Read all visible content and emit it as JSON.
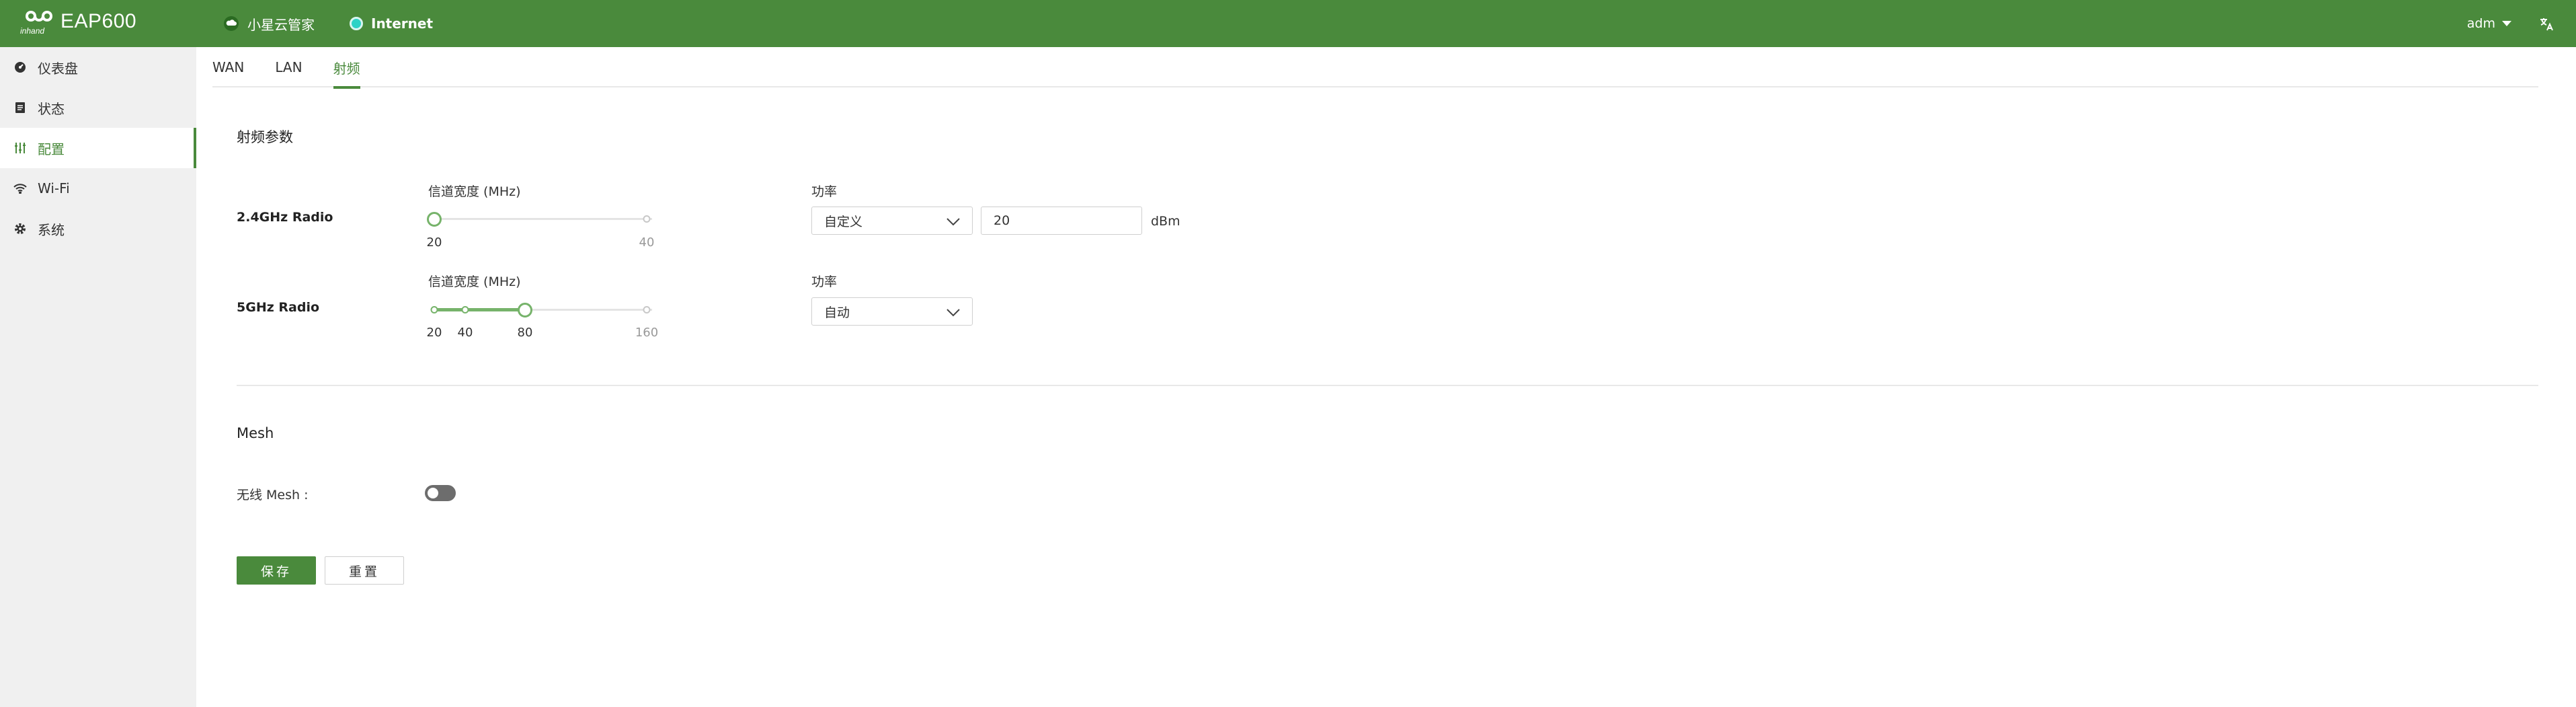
{
  "header": {
    "brand": "EAP600",
    "nav": [
      {
        "label": "小星云管家",
        "icon": "cloud-icon"
      },
      {
        "label": "Internet",
        "icon": "status-dot-icon"
      }
    ],
    "user": "adm",
    "accent": "#4a8a3c"
  },
  "sidebar": {
    "items": [
      {
        "label": "仪表盘",
        "icon": "dashboard-icon"
      },
      {
        "label": "状态",
        "icon": "status-icon"
      },
      {
        "label": "配置",
        "icon": "config-icon",
        "active": true
      },
      {
        "label": "Wi-Fi",
        "icon": "wifi-icon"
      },
      {
        "label": "系统",
        "icon": "gear-icon"
      }
    ]
  },
  "tabs": [
    {
      "label": "WAN"
    },
    {
      "label": "LAN"
    },
    {
      "label": "射频",
      "active": true
    }
  ],
  "radio": {
    "title": "射频参数",
    "band24": {
      "label": "2.4GHz Radio",
      "width_label": "信道宽度 (MHz)",
      "width_options": [
        "20",
        "40"
      ],
      "width_value": "20",
      "power_label": "功率",
      "power_mode": "自定义",
      "power_value": "20",
      "power_unit": "dBm"
    },
    "band5": {
      "label": "5GHz Radio",
      "width_label": "信道宽度 (MHz)",
      "width_options": [
        "20",
        "40",
        "80",
        "160"
      ],
      "width_value": "80",
      "power_label": "功率",
      "power_mode": "自动"
    }
  },
  "mesh": {
    "title": "Mesh",
    "wireless_label": "无线 Mesh :",
    "wireless_enabled": false
  },
  "actions": {
    "save": "保存",
    "reset": "重置"
  }
}
